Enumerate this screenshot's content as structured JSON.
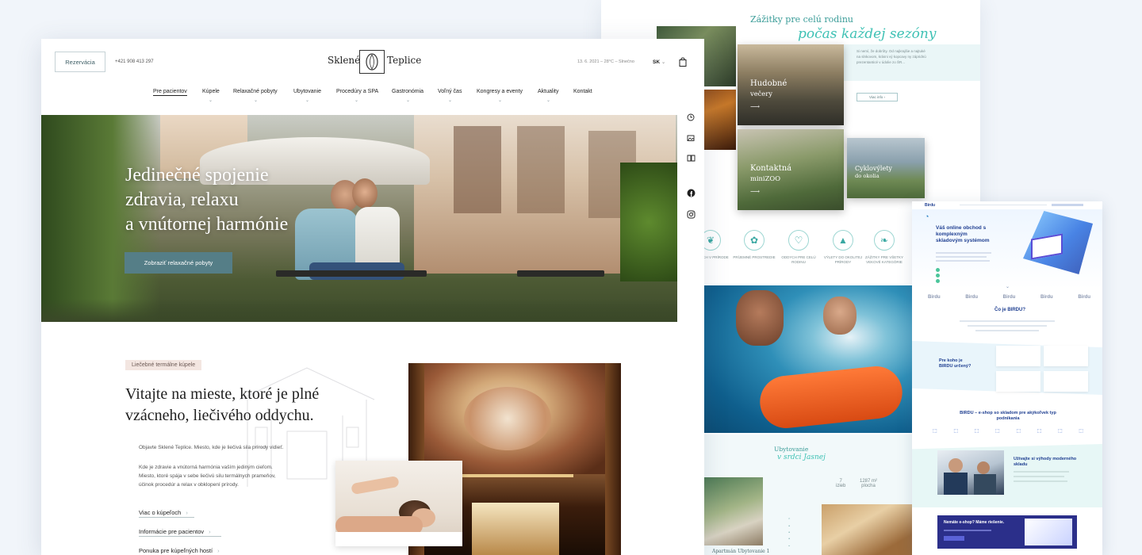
{
  "right_card": {
    "section_title": "Zážitky pre celú rodinu",
    "section_script": "počas každej sezóny",
    "intro_text": "Si nemí, že dobrôty. Od najkrajšie a najtuké na slnkovom, krásni vý kopcavy ny zápridnú prezentanticé v údolie zo ŠR...",
    "more_button": "Viac info",
    "tiles": [
      {
        "line1": "Hudobné",
        "line2": "večery"
      },
      {
        "line1": "Kontaktná",
        "line2": "miniZOO"
      },
      {
        "line1": "Cyklovýlety",
        "line2": "do okolia"
      }
    ],
    "features": [
      {
        "icon": "leaf-icon",
        "text": "Oddych v prírode"
      },
      {
        "icon": "flower-icon",
        "text": "Príjemné prostredie"
      },
      {
        "icon": "heart-icon",
        "text": "Oddych pre celú rodinu"
      },
      {
        "icon": "mountain-icon",
        "text": "Výlety do okolitej prírody"
      },
      {
        "icon": "leaf-icon",
        "text": "Zážitky pre všetky vekové kategórie"
      }
    ],
    "acc_title": "Ubytovanie",
    "acc_script": "v srdci Jasnej",
    "stats": [
      {
        "value": "7",
        "label": "izieb"
      },
      {
        "value": "1287 m²",
        "label": "plocha"
      }
    ],
    "room_caption": "Apartmán Ubytovanie 1"
  },
  "birdu": {
    "logo": "Birdu",
    "hero_title": "Váš online obchod s komplexným skladovým systémom",
    "logos": [
      "Birdu",
      "Birdu",
      "Birdu",
      "Birdu",
      "Birdu"
    ],
    "what_title": "Čo je BIRDU?",
    "who_title": "Pre koho je BIRDU určený?",
    "eshop_title": "BIRDU – e-shop so skladom pre akýkoľvek typ podnikania",
    "benefit_title": "Užívajte si výhody moderného skladu",
    "cta_title": "Nemáte e-shop? Máme riešenie."
  },
  "main": {
    "reservation_button": "Rezervácia",
    "phone": "+421 908 413 297",
    "logo_left": "Sklené",
    "logo_right": "Teplice",
    "date": "13. 6. 2021 – 28°C – Slnečno",
    "language": "SK",
    "nav": [
      "Pre pacientov",
      "Kúpele",
      "Relaxačné pobyty",
      "Ubytovanie",
      "Procedúry a SPA",
      "Gastronómia",
      "Voľný čas",
      "Kongresy a eventy",
      "Aktuality",
      "Kontakt"
    ],
    "hero": {
      "line1": "Jedinečné spojenie",
      "line2": "zdravia, relaxu",
      "line3": "a vnútornej harmónie",
      "cta": "Zobraziť relaxačné pobyty"
    },
    "side_icons": [
      "clock-icon",
      "image-icon",
      "book-icon",
      "facebook-icon",
      "instagram-icon"
    ],
    "tag": "Liečebné termálne kúpele",
    "headline1": "Vitajte na mieste, ktoré je plné",
    "headline2": "vzácneho, liečivého oddychu.",
    "para1": "Objavte Sklené Teplice. Miesto, kde je liečivá sila prírody vidieť.",
    "para2a": "Kde je zdravie a vnútorná harmónia vaším jediným cieľom.",
    "para2b": "Miesto, ktoré spája v sebe liečivú silu termálnych prameňov,",
    "para2c": "účinok procedúr a relax v obklopení prírody.",
    "links": [
      "Viac o kúpeľoch",
      "Informácie pre pacientov",
      "Ponuka pre kúpeľných hostí"
    ]
  }
}
